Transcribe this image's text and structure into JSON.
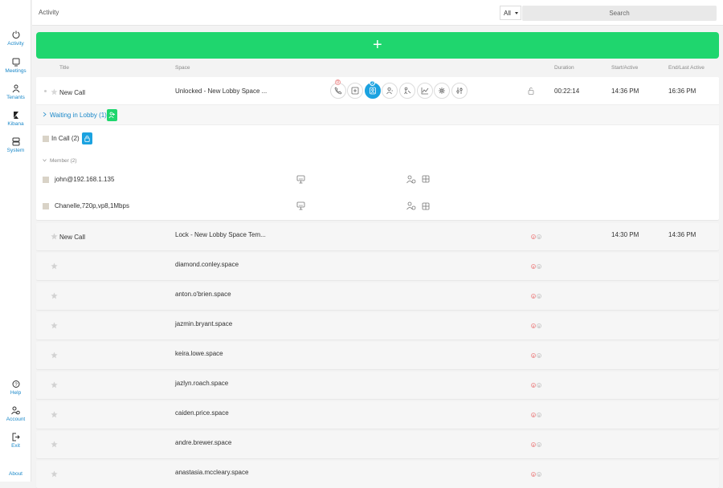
{
  "sidebar": {
    "items": [
      {
        "label": "Activity",
        "icon": "activity-icon"
      },
      {
        "label": "Meetings",
        "icon": "meetings-icon"
      },
      {
        "label": "Tenants",
        "icon": "tenants-icon"
      },
      {
        "label": "Kibana",
        "icon": "kibana-icon"
      },
      {
        "label": "System",
        "icon": "system-icon"
      }
    ],
    "bottom": [
      {
        "label": "Help",
        "icon": "help-icon"
      },
      {
        "label": "Account",
        "icon": "account-icon"
      },
      {
        "label": "Exit",
        "icon": "exit-icon"
      }
    ],
    "about": "About"
  },
  "header": {
    "title": "Activity",
    "filter_value": "All",
    "search_placeholder": "Search"
  },
  "add_button": {
    "label": "+"
  },
  "columns": {
    "title": "Title",
    "space": "Space",
    "duration": "Duration",
    "start": "Start/Active",
    "end": "End/Last Active"
  },
  "active_call": {
    "title": "New Call",
    "space": "Unlocked - New Lobby Space ...",
    "duration": "00:22:14",
    "start": "14:36 PM",
    "end": "16:36 PM",
    "dial_badge": "0",
    "participants_badge": "2",
    "waiting_label": "Waiting in Lobby (1)",
    "in_call_label": "In Call (2)",
    "member_label": "Member (2)",
    "members": [
      {
        "name": "john@192.168.1.135"
      },
      {
        "name": "Chanelle,720p,vp8,1Mbps"
      }
    ]
  },
  "calls": [
    {
      "title": "New Call",
      "space": "Lock - New Lobby Space Tem...",
      "count_a": "2",
      "count_b": "0",
      "start": "14:30 PM",
      "end": "14:36 PM"
    },
    {
      "title": "",
      "space": "diamond.conley.space",
      "count_a": "0",
      "count_b": "0",
      "start": "",
      "end": ""
    },
    {
      "title": "",
      "space": "anton.o'brien.space",
      "count_a": "0",
      "count_b": "0",
      "start": "",
      "end": ""
    },
    {
      "title": "",
      "space": "jazmin.bryant.space",
      "count_a": "0",
      "count_b": "0",
      "start": "",
      "end": ""
    },
    {
      "title": "",
      "space": "keira.lowe.space",
      "count_a": "0",
      "count_b": "0",
      "start": "",
      "end": ""
    },
    {
      "title": "",
      "space": "jazlyn.roach.space",
      "count_a": "0",
      "count_b": "0",
      "start": "",
      "end": ""
    },
    {
      "title": "",
      "space": "caiden.price.space",
      "count_a": "0",
      "count_b": "0",
      "start": "",
      "end": ""
    },
    {
      "title": "",
      "space": "andre.brewer.space",
      "count_a": "0",
      "count_b": "0",
      "start": "",
      "end": ""
    },
    {
      "title": "",
      "space": "anastasia.mccleary.space",
      "count_a": "0",
      "count_b": "0",
      "start": "",
      "end": ""
    }
  ],
  "colors": {
    "accent_blue": "#1a88c9",
    "add_green": "#1fd66e",
    "active_blue": "#1ba2e0",
    "badge_red": "#d44444"
  }
}
